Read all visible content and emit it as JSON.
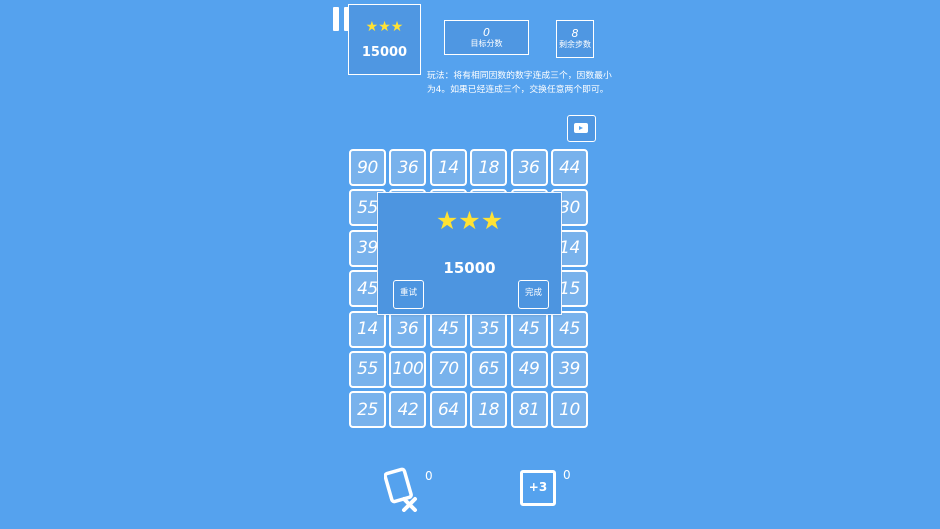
{
  "hud": {
    "stars": "★★★",
    "score": "15000",
    "target_value": "0",
    "target_label": "目标分数",
    "steps_value": "8",
    "steps_label": "剩余步数",
    "rules": "玩法：将有相同因数的数字连成三个，因数最小为4。如果已经连成三个，交换任意两个即可。"
  },
  "grid": [
    [
      "90",
      "36",
      "14",
      "18",
      "36",
      "44"
    ],
    [
      "55",
      "",
      "",
      "",
      "",
      "30"
    ],
    [
      "39",
      "",
      "",
      "",
      "",
      "14"
    ],
    [
      "45",
      "",
      "",
      "",
      "",
      "15"
    ],
    [
      "14",
      "36",
      "45",
      "35",
      "45",
      "45"
    ],
    [
      "55",
      "100",
      "70",
      "65",
      "49",
      "39"
    ],
    [
      "25",
      "42",
      "64",
      "18",
      "81",
      "10"
    ]
  ],
  "popup": {
    "stars": "★★★",
    "score": "15000",
    "retry_label": "重试",
    "done_label": "完成"
  },
  "tools": {
    "shuffle_count": "0",
    "plus3_label": "+3",
    "plus3_count": "0"
  },
  "colors": {
    "background": "#55a2ee",
    "star": "#ffe234",
    "tile": "#78b2ec",
    "panel": "#4d95e0"
  }
}
